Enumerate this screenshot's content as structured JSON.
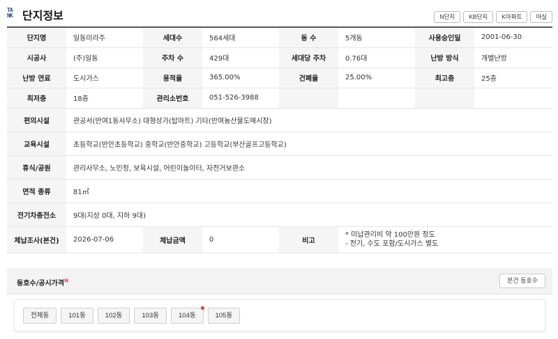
{
  "header": {
    "logo_line1": "TA",
    "logo_line2": "NK",
    "title": "단지정보",
    "buttons": [
      "N단지",
      "KB단지",
      "K아파트",
      "아실"
    ]
  },
  "rows": [
    {
      "cells": [
        {
          "label": "단지명",
          "value": "일동미라주"
        },
        {
          "label": "세대수",
          "value": "564세대"
        },
        {
          "label": "동 수",
          "value": "5개동"
        },
        {
          "label": "사용승인일",
          "value": "2001-06-30"
        }
      ]
    },
    {
      "cells": [
        {
          "label": "시공사",
          "value": "(주)일동"
        },
        {
          "label": "주차 수",
          "value": "429대"
        },
        {
          "label": "세대당 주차",
          "value": "0.76대"
        },
        {
          "label": "난방 방식",
          "value": "개별난방"
        }
      ]
    },
    {
      "cells": [
        {
          "label": "난방 연료",
          "value": "도시가스"
        },
        {
          "label": "용적율",
          "value": "365.00%"
        },
        {
          "label": "건폐율",
          "value": "25.00%"
        },
        {
          "label": "최고층",
          "value": "25층"
        }
      ]
    },
    {
      "cells": [
        {
          "label": "최저층",
          "value": "18층"
        },
        {
          "label": "관리소번호",
          "value": "051-526-3988"
        },
        {
          "label": "",
          "value": ""
        },
        {
          "label": "",
          "value": ""
        }
      ]
    }
  ],
  "wide_rows": [
    {
      "label": "편의시설",
      "value": "관공서(반여1동사무소) 대형상가(탑마트) 기타(반여농산물도매시장)"
    },
    {
      "label": "교육시설",
      "value": "초등학교(반안초등학교) 중학교(반안중학교) 고등학교(부산골프고등학교)"
    },
    {
      "label": "휴식/공원",
      "value": "관리사무소, 노인정, 보육시설, 어린이놀이터, 자전거보관소"
    },
    {
      "label": "면적 종류",
      "value": "81㎡"
    },
    {
      "label": "전기차충전소",
      "value": "9대(지상 0대, 지하 9대)"
    }
  ],
  "arrears": {
    "label": "체납조사(본건)",
    "date": "2026-07-06",
    "amount_label": "체납금액",
    "amount": "0",
    "note_label": "비고",
    "note_line1": "* 미납관리비 약 100만원 정도",
    "note_line2": "- 전기, 수도 포함/도시가스 별도"
  },
  "subsection": {
    "title": "동호수/공시가격",
    "badge": "N",
    "button": "본건 동호수"
  },
  "dong_tabs": [
    "전체동",
    "101동",
    "102동",
    "103동",
    "104동",
    "105동"
  ],
  "colors": {
    "accent": "#1f4e96",
    "badge": "#e53935"
  }
}
